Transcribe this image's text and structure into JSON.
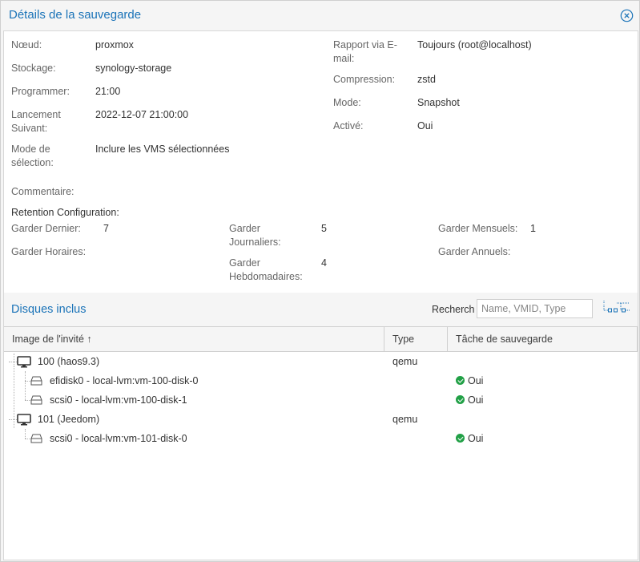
{
  "dialog": {
    "title": "Détails de la sauvegarde"
  },
  "details": {
    "node_label": "Nœud:",
    "node_value": "proxmox",
    "storage_label": "Stockage:",
    "storage_value": "synology-storage",
    "schedule_label": "Programmer:",
    "schedule_value": "21:00",
    "next_run_label_1": "Lancement",
    "next_run_label_2": "Suivant:",
    "next_run_value": "2022-12-07 21:00:00",
    "selection_label_1": "Mode de",
    "selection_label_2": "sélection:",
    "selection_value": "Inclure les VMS sélectionnées",
    "comment_label": "Commentaire:",
    "mail_label_1": "Rapport via E-",
    "mail_label_2": "mail:",
    "mail_value": "Toujours (root@localhost)",
    "compression_label": "Compression:",
    "compression_value": "zstd",
    "mode_label": "Mode:",
    "mode_value": "Snapshot",
    "enabled_label": "Activé:",
    "enabled_value": "Oui"
  },
  "retention": {
    "title": "Retention Configuration:",
    "keep_last_label": "Garder Dernier:",
    "keep_last_value": "7",
    "keep_hourly_label": "Garder Horaires:",
    "keep_daily_label_1": "Garder",
    "keep_daily_label_2": "Journaliers:",
    "keep_daily_value": "5",
    "keep_weekly_label_1": "Garder",
    "keep_weekly_label_2": "Hebdomadaires:",
    "keep_weekly_value": "4",
    "keep_monthly_label": "Garder Mensuels:",
    "keep_monthly_value": "1",
    "keep_yearly_label": "Garder Annuels:"
  },
  "disks": {
    "title": "Disques inclus",
    "search_label": "Recherch",
    "search_placeholder": "Name, VMID, Type",
    "columns": {
      "guest": "Image de l'invité ↑",
      "type": "Type",
      "backup": "Tâche de sauvegarde"
    },
    "rows": [
      {
        "name": "100 (haos9.3)",
        "type": "qemu",
        "backup": ""
      },
      {
        "name": "efidisk0 - local-lvm:vm-100-disk-0",
        "type": "",
        "backup": "Oui"
      },
      {
        "name": "scsi0 - local-lvm:vm-100-disk-1",
        "type": "",
        "backup": "Oui"
      },
      {
        "name": "101 (Jeedom)",
        "type": "qemu",
        "backup": ""
      },
      {
        "name": "scsi0 - local-lvm:vm-101-disk-0",
        "type": "",
        "backup": "Oui"
      }
    ]
  },
  "colors": {
    "accent": "#1a73b8",
    "ok": "#21a046"
  },
  "icons": {
    "close": "close-circle-icon",
    "expand": "expand-tree-icon",
    "vm": "monitor-icon",
    "disk": "hard-disk-icon",
    "ok": "check-circle-icon",
    "sort": "sort-ascending-icon"
  }
}
